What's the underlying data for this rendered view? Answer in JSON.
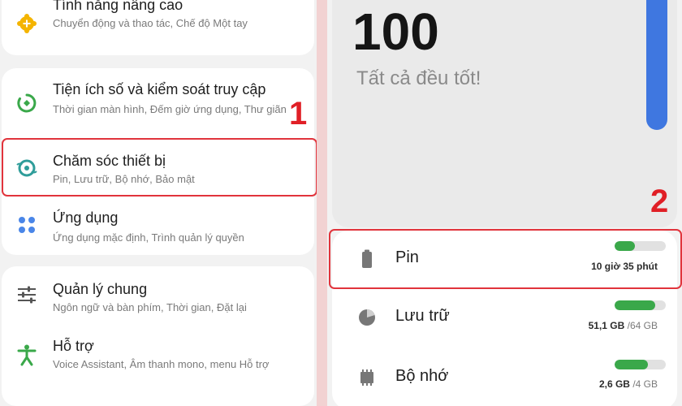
{
  "settings": [
    {
      "title": "Tính năng nâng cao",
      "subtitle": "Chuyển động và thao tác, Chế độ Một tay",
      "icon": "gear-plus-icon"
    },
    {
      "title": "Tiện ích số và kiểm soát truy cập",
      "subtitle": "Thời gian màn hình, Đếm giờ ứng dụng, Thư giãn",
      "icon": "digital-wellbeing-icon"
    },
    {
      "title": "Chăm sóc thiết bị",
      "subtitle": "Pin, Lưu trữ, Bộ nhớ, Bảo mật",
      "icon": "device-care-icon"
    },
    {
      "title": "Ứng dụng",
      "subtitle": "Ứng dụng mặc định, Trình quản lý quyền",
      "icon": "apps-grid-icon"
    },
    {
      "title": "Quản lý chung",
      "subtitle": "Ngôn ngữ và bàn phím, Thời gian, Đặt lại",
      "icon": "sliders-icon"
    },
    {
      "title": "Hỗ trợ",
      "subtitle": "Voice Assistant, Âm thanh mono, menu Hỗ trợ",
      "icon": "accessibility-icon"
    }
  ],
  "step_markers": {
    "left": "1",
    "right": "2"
  },
  "device_care": {
    "score": "100",
    "status": "Tất cả đều tốt!",
    "items": [
      {
        "label": "Pin",
        "value": "10 giờ 35 phút",
        "level": 0.4,
        "icon": "battery-icon"
      },
      {
        "label": "Lưu trữ",
        "used": "51,1 GB",
        "total": "/64 GB",
        "level": 0.8,
        "icon": "storage-pie-icon"
      },
      {
        "label": "Bộ nhớ",
        "used": "2,6 GB",
        "total": "/4 GB",
        "level": 0.65,
        "icon": "memory-chip-icon"
      }
    ]
  },
  "colors": {
    "highlight": "#e1343c",
    "marker": "#e01f26",
    "accent_green": "#3aa84a",
    "score_bar": "#3f77e0",
    "settings_icon_orange": "#f4b400",
    "settings_icon_green": "#3aa84a",
    "settings_icon_blue": "#4a86e8"
  }
}
